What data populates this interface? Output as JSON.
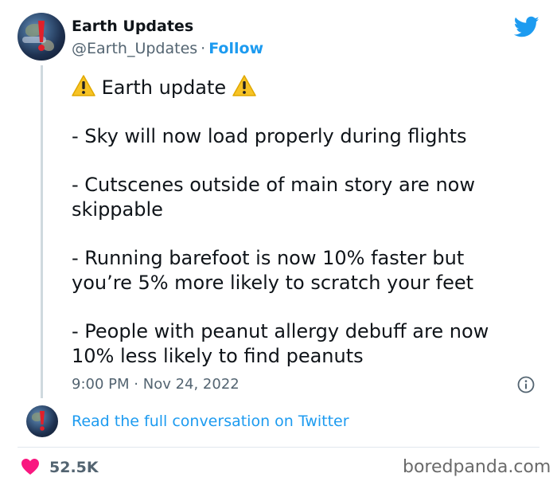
{
  "tweet": {
    "author_name": "Earth Updates",
    "author_handle": "@Earth_Updates",
    "separator": "·",
    "follow_label": "Follow",
    "brand_color": "#1d9bf0",
    "body": {
      "headline": "Earth update",
      "line1": "- Sky will now load properly during flights",
      "line2a": "- Cutscenes outside of main story are now",
      "line2b": "skippable",
      "line3a": "- Running barefoot is now 10% faster but",
      "line3b": "you’re 5% more likely to scratch your feet",
      "line4a": "- People with peanut allergy debuff are now",
      "line4b": "10% less likely to find peanuts"
    },
    "time": "9:00 PM",
    "date": "Nov 24, 2022",
    "read_conversation": "Read the full conversation on Twitter",
    "likes": "52.5K"
  },
  "icons": {
    "brand": "twitter-bird-icon",
    "warning": "warning-icon",
    "info": "info-icon",
    "like": "heart-icon"
  },
  "watermark": "boredpanda.com"
}
